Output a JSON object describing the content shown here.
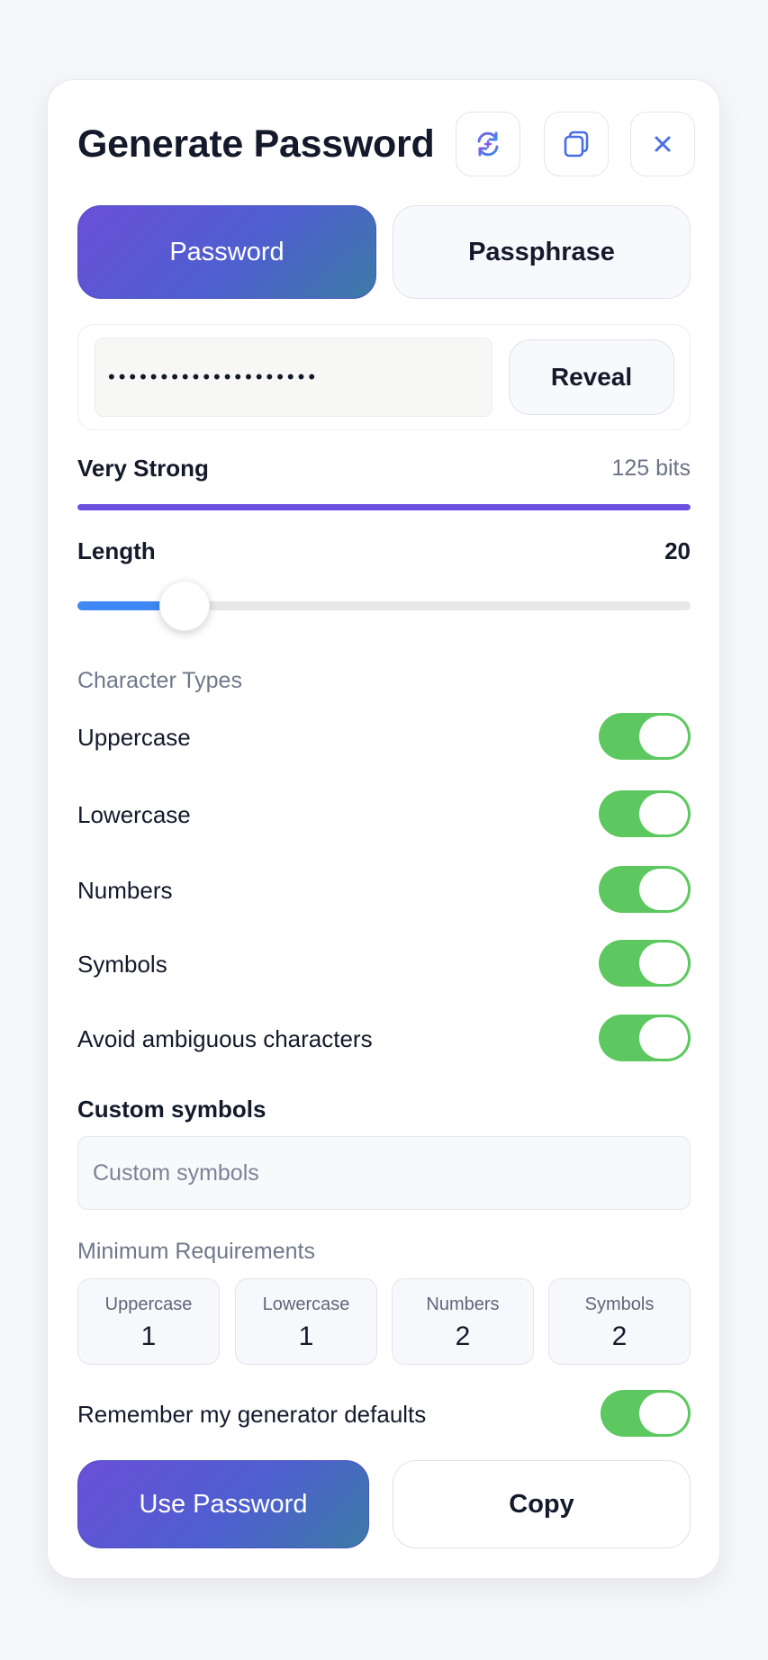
{
  "header": {
    "title": "Generate Password",
    "regenerate_icon": "refresh-icon",
    "copy_icon": "copy-icon",
    "close_icon": "close-icon"
  },
  "tabs": [
    {
      "label": "Password",
      "active": true
    },
    {
      "label": "Passphrase",
      "active": false
    }
  ],
  "password": {
    "masked_value": "••••••••••••••••••••",
    "reveal_label": "Reveal"
  },
  "strength": {
    "label": "Very Strong",
    "bits": "125 bits",
    "fill_fraction": 1.0,
    "color": "#6a4fe0"
  },
  "length": {
    "label": "Length",
    "value": "20",
    "slider_fraction": 0.14
  },
  "character_types": {
    "heading": "Character Types",
    "options": [
      {
        "label": "Uppercase",
        "on": true
      },
      {
        "label": "Lowercase",
        "on": true
      },
      {
        "label": "Numbers",
        "on": true
      },
      {
        "label": "Symbols",
        "on": true
      },
      {
        "label": "Avoid ambiguous characters",
        "on": true
      }
    ]
  },
  "custom_symbols": {
    "label": "Custom symbols",
    "placeholder": "Custom symbols",
    "value": ""
  },
  "minimum_requirements": {
    "heading": "Minimum Requirements",
    "items": [
      {
        "label": "Uppercase",
        "value": "1"
      },
      {
        "label": "Lowercase",
        "value": "1"
      },
      {
        "label": "Numbers",
        "value": "2"
      },
      {
        "label": "Symbols",
        "value": "2"
      }
    ]
  },
  "remember": {
    "label": "Remember my generator defaults",
    "on": true
  },
  "actions": {
    "primary_label": "Use Password",
    "secondary_label": "Copy"
  },
  "colors": {
    "accent_gradient_start": "#6a4fd8",
    "accent_gradient_end": "#3c7aa6",
    "toggle_on": "#5cc85f",
    "slider_fill": "#3f88f5"
  }
}
